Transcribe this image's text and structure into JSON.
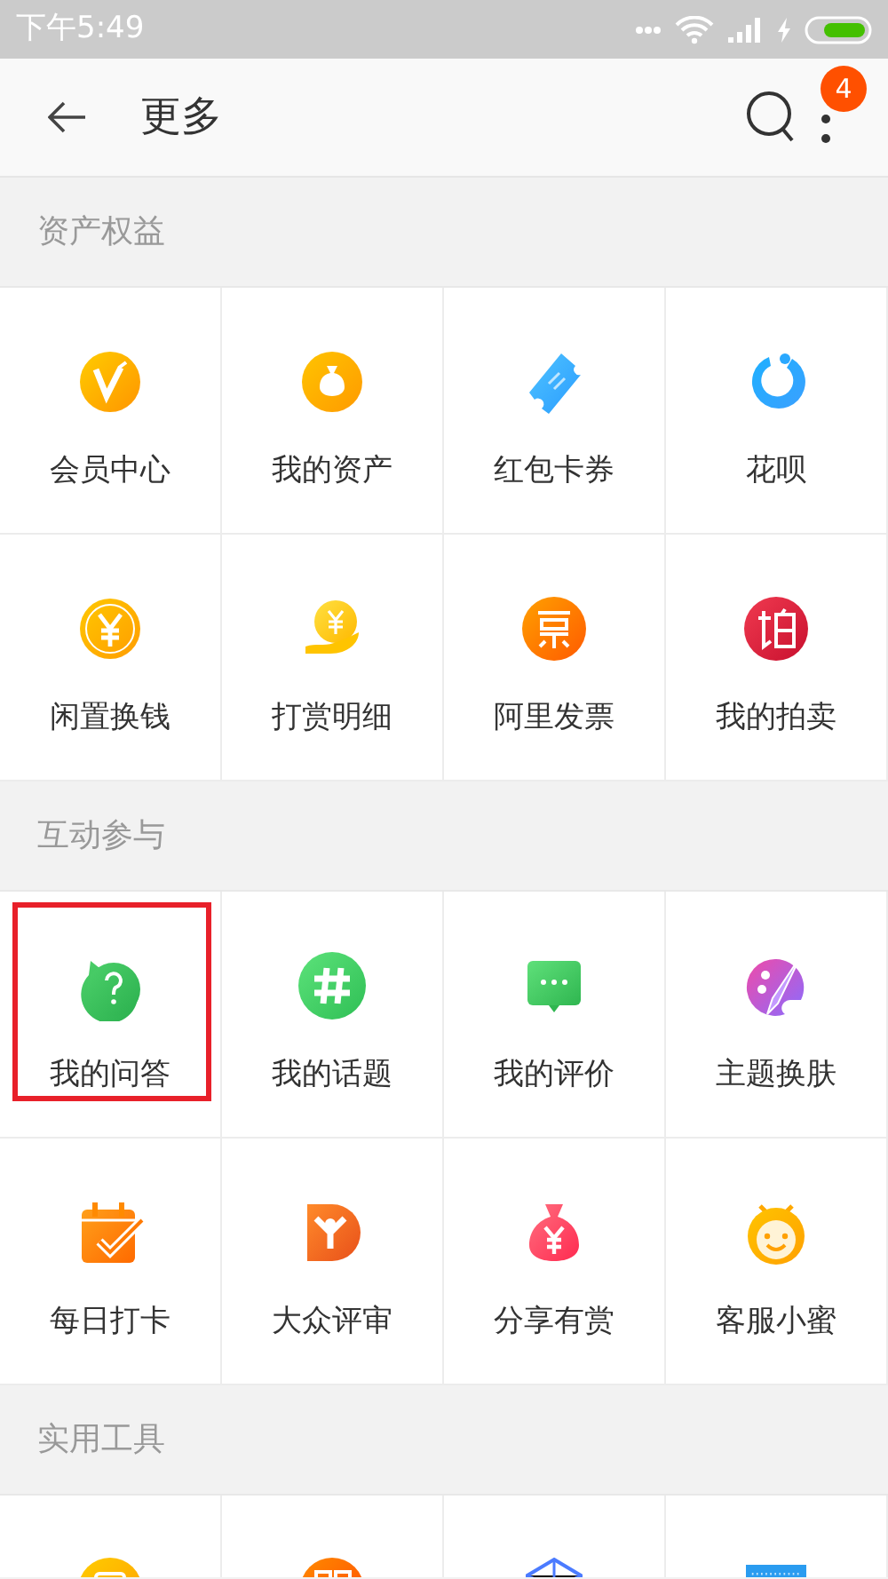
{
  "status_bar": {
    "time": "下午5:49"
  },
  "header": {
    "title": "更多",
    "badge": "4"
  },
  "sections": [
    {
      "title": "资产权益",
      "items": [
        {
          "label": "会员中心",
          "highlighted": false
        },
        {
          "label": "我的资产",
          "highlighted": false
        },
        {
          "label": "红包卡券",
          "highlighted": false
        },
        {
          "label": "花呗",
          "highlighted": false
        },
        {
          "label": "闲置换钱",
          "highlighted": false
        },
        {
          "label": "打赏明细",
          "highlighted": false
        },
        {
          "label": "阿里发票",
          "highlighted": false
        },
        {
          "label": "我的拍卖",
          "highlighted": false
        }
      ]
    },
    {
      "title": "互动参与",
      "items": [
        {
          "label": "我的问答",
          "highlighted": true
        },
        {
          "label": "我的话题",
          "highlighted": false
        },
        {
          "label": "我的评价",
          "highlighted": false
        },
        {
          "label": "主题换肤",
          "highlighted": false
        },
        {
          "label": "每日打卡",
          "highlighted": false
        },
        {
          "label": "大众评审",
          "highlighted": false
        },
        {
          "label": "分享有赏",
          "highlighted": false
        },
        {
          "label": "客服小蜜",
          "highlighted": false
        }
      ]
    },
    {
      "title": "实用工具",
      "items": [
        {
          "highlighted": false
        },
        {
          "highlighted": false
        },
        {
          "highlighted": false
        },
        {
          "highlighted": false
        }
      ]
    }
  ]
}
